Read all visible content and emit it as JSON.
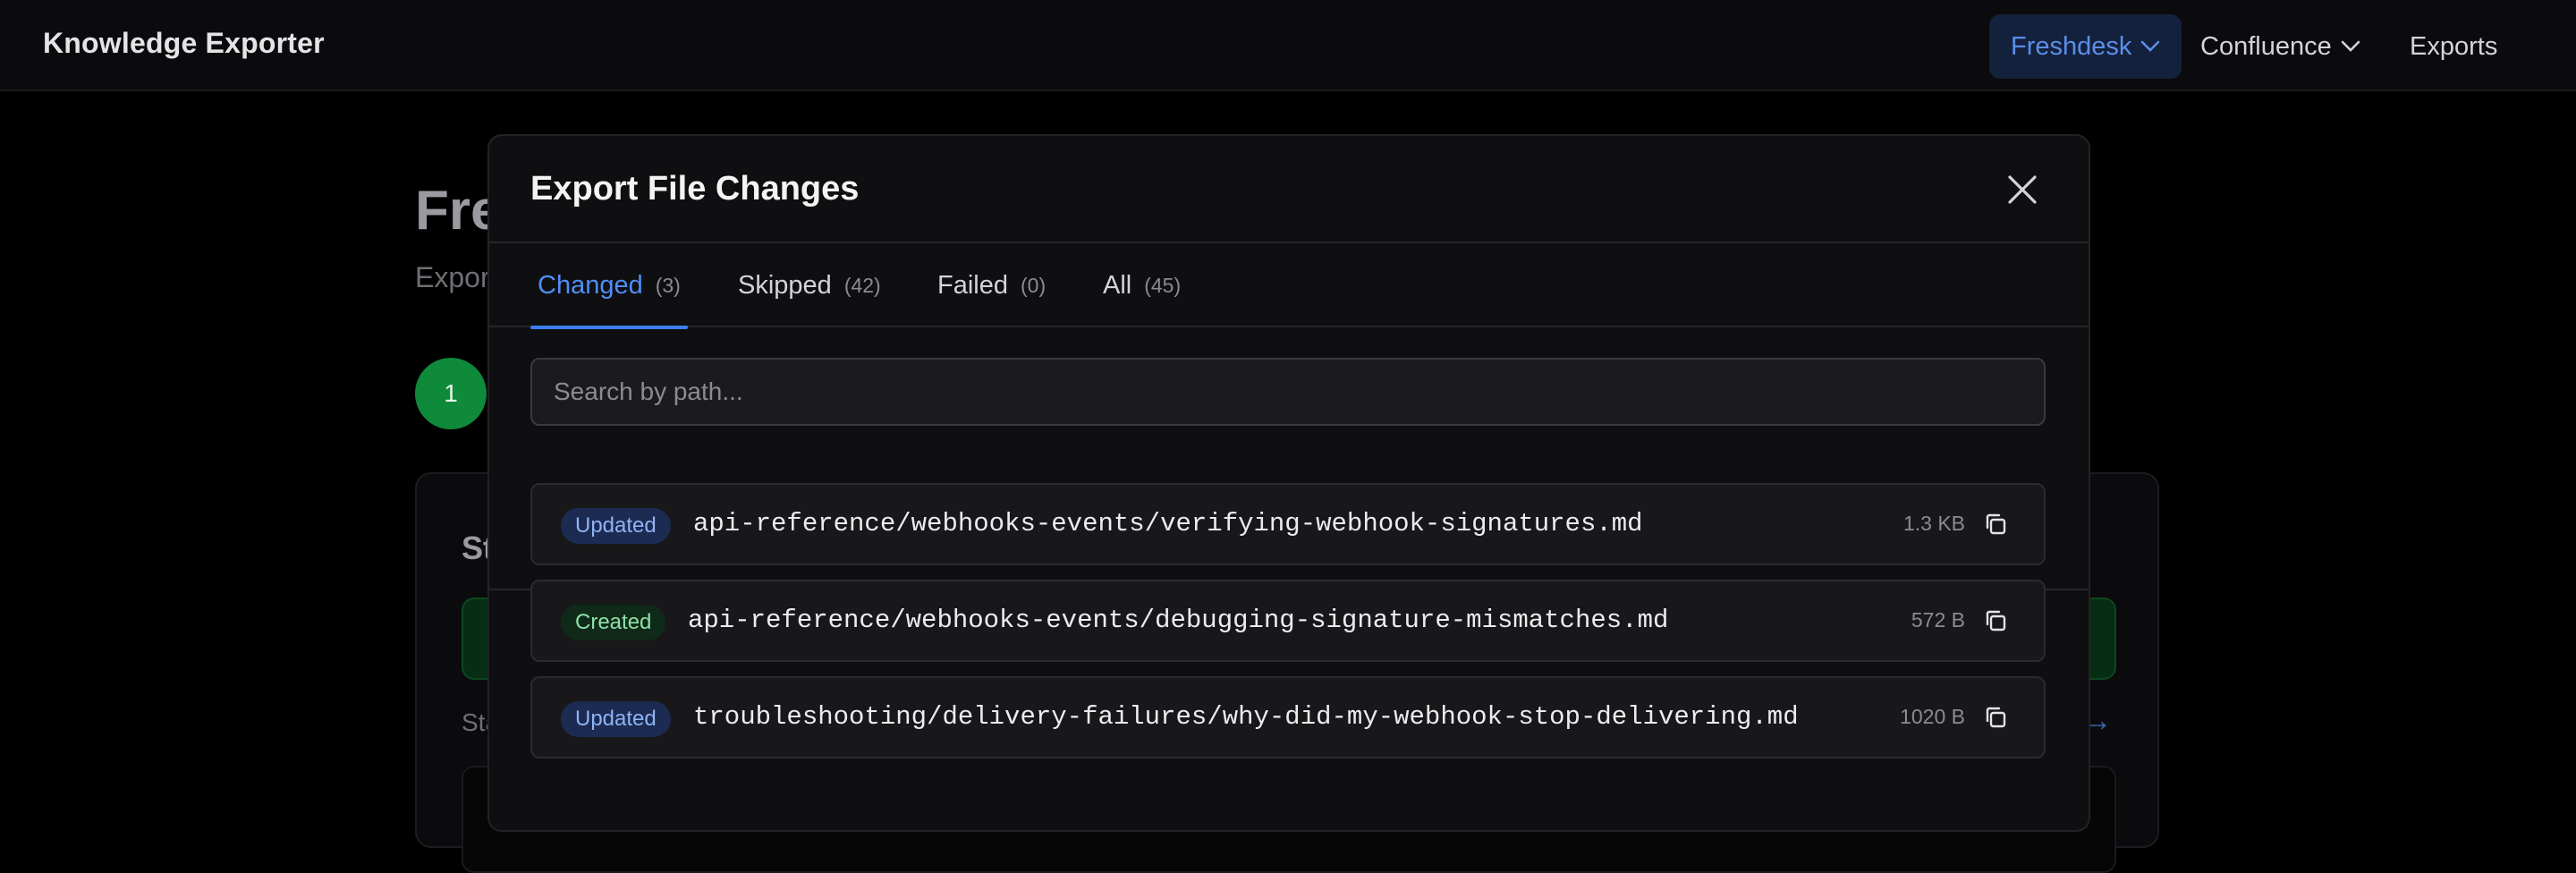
{
  "app": {
    "title": "Knowledge Exporter"
  },
  "nav": {
    "items": [
      {
        "label": "Freshdesk",
        "active": true,
        "dropdown": true
      },
      {
        "label": "Confluence",
        "active": false,
        "dropdown": true
      },
      {
        "label": "Exports",
        "active": false,
        "dropdown": false
      }
    ]
  },
  "background": {
    "title": "Fre",
    "subtitle": "Expor",
    "step": "1",
    "card_title": "St",
    "card_label": "Sta",
    "arrow": "→"
  },
  "modal": {
    "title": "Export File Changes",
    "tabs": [
      {
        "label": "Changed",
        "count": "(3)",
        "active": true
      },
      {
        "label": "Skipped",
        "count": "(42)",
        "active": false
      },
      {
        "label": "Failed",
        "count": "(0)",
        "active": false
      },
      {
        "label": "All",
        "count": "(45)",
        "active": false
      }
    ],
    "search": {
      "placeholder": "Search by path...",
      "value": ""
    },
    "files": [
      {
        "status": "Updated",
        "path": "api-reference/webhooks-events/verifying-webhook-signatures.md",
        "size": "1.3 KB"
      },
      {
        "status": "Created",
        "path": "api-reference/webhooks-events/debugging-signature-mismatches.md",
        "size": "572 B"
      },
      {
        "status": "Updated",
        "path": "troubleshooting/delivery-failures/why-did-my-webhook-stop-delivering.md",
        "size": "1020 B"
      }
    ]
  },
  "colors": {
    "accent": "#4f8ef7",
    "updated_badge": "#1c2b52",
    "created_badge": "#0f2a19"
  }
}
